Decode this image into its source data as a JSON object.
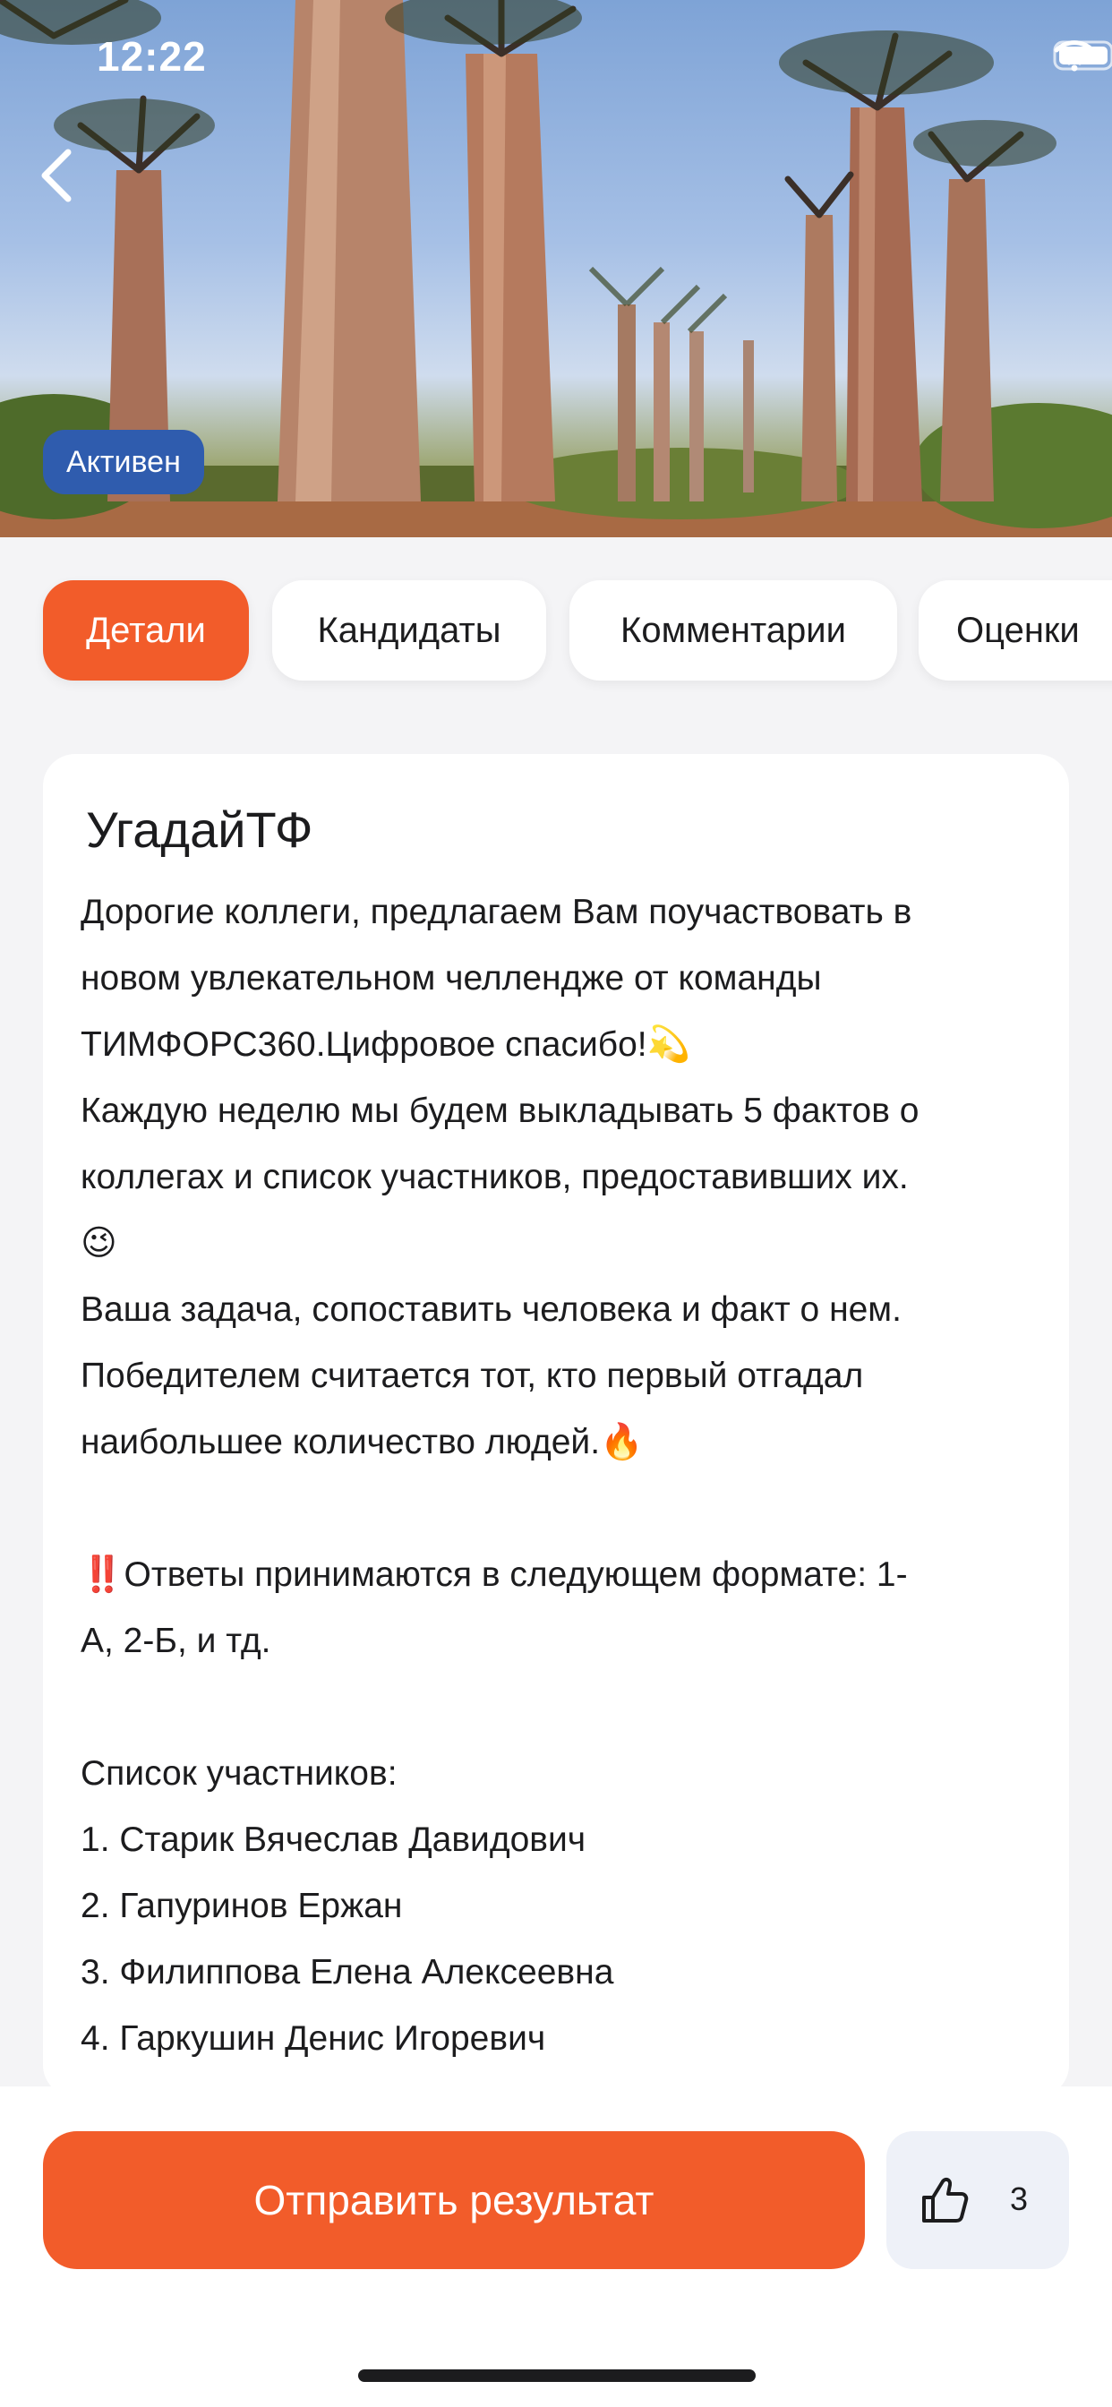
{
  "status_bar": {
    "time": "12:22"
  },
  "hero": {
    "status_label": "Активен",
    "icon_back": "chevron-left-icon"
  },
  "tabs": [
    {
      "label": "Детали",
      "active": true
    },
    {
      "label": "Кандидаты",
      "active": false
    },
    {
      "label": "Комментарии",
      "active": false
    },
    {
      "label": "Оценки",
      "active": false
    }
  ],
  "card": {
    "title": "УгадайТФ",
    "lines": [
      "Дорогие коллеги, предлагаем Вам поучаствовать в",
      "новом увлекательном челлендже от команды",
      "ТИМФОРС360.Цифровое спасибо!💫",
      "Каждую неделю мы будем выкладывать 5 фактов о",
      "коллегах и список участников, предоставивших их.",
      "😉",
      "Ваша задача, сопоставить человека и факт о нем.",
      "Победителем считается тот, кто первый отгадал",
      "наибольшее количество людей.🔥",
      "",
      "‼️Ответы принимаются в следующем формате: 1-",
      "А, 2-Б, и тд.",
      "",
      "Список участников:",
      "1. Старик Вячеслав Давидович",
      "2. Гапуринов Ержан",
      "3. Филиппова Елена Алексеевна",
      "4. Гаркушин Денис Игоревич"
    ]
  },
  "actions": {
    "submit_label": "Отправить результат",
    "like_count": "3"
  },
  "colors": {
    "accent": "#f25c2a",
    "status_blue": "#2f5cae",
    "like_bg": "#eef1f8"
  }
}
